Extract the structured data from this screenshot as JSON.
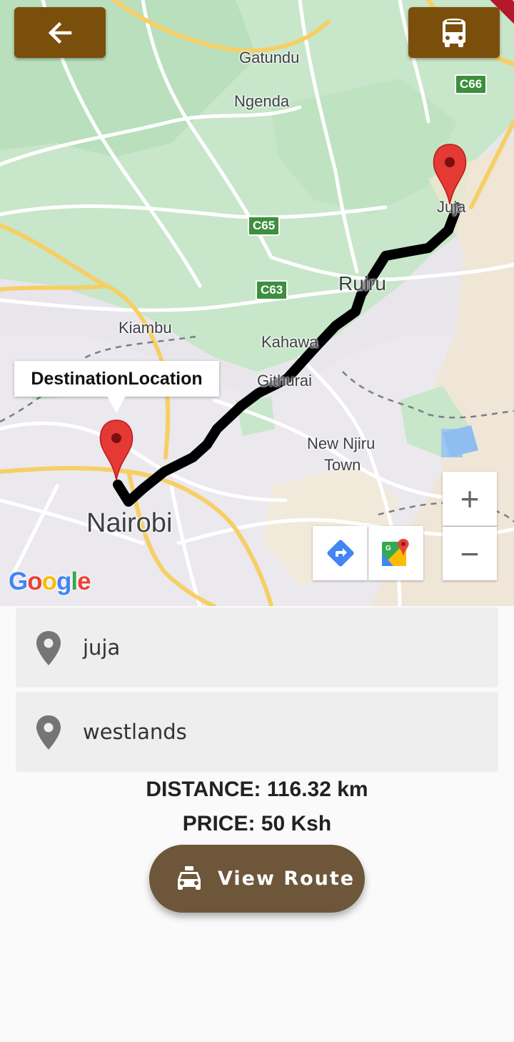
{
  "top_bar": {
    "back_icon": "arrow-left-icon",
    "bus_icon": "bus-icon",
    "button_color": "#7a4f0c"
  },
  "map": {
    "place_labels": [
      "Gatundu",
      "Ngenda",
      "Juja",
      "Ruiru",
      "Kiambu",
      "Kahawa",
      "Githurai",
      "New Njiru",
      "Town",
      "Nairobi"
    ],
    "road_badges": [
      "C66",
      "C65",
      "C63"
    ],
    "info_window": "DestinationLocation",
    "route_color": "#000000",
    "marker_color": "#e53935",
    "attribution": "Google",
    "controls": {
      "directions_icon": "directions-icon",
      "google_maps_icon": "google-maps-icon",
      "zoom_in": "+",
      "zoom_out": "−"
    }
  },
  "form": {
    "origin": "juja",
    "destination": "westlands"
  },
  "info": {
    "distance": "DISTANCE: 116.32 km",
    "price": "PRICE: 50 Ksh"
  },
  "action": {
    "label": "View Route",
    "icon": "taxi-icon",
    "color": "#6d563a"
  }
}
